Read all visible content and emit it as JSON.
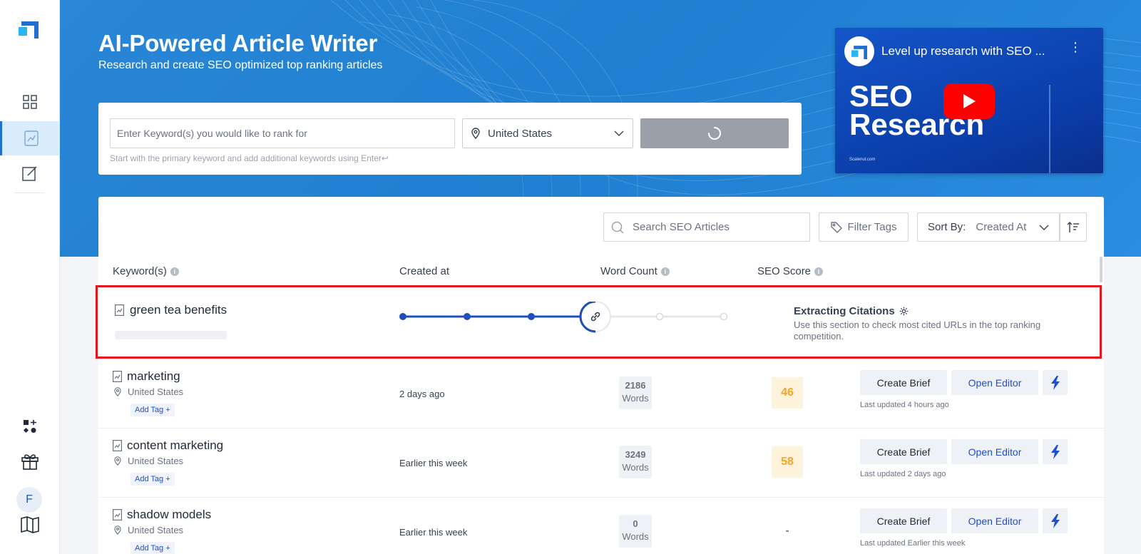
{
  "sidebar": {
    "items": [
      {
        "icon": "dashboard-grid-icon"
      },
      {
        "icon": "article-writer-icon",
        "active": true
      },
      {
        "icon": "edit-document-icon"
      }
    ],
    "bottom": [
      {
        "icon": "apps-add-icon"
      },
      {
        "icon": "gift-icon"
      },
      {
        "icon": "book-icon"
      }
    ],
    "avatar_letter": "F"
  },
  "hero": {
    "title": "AI-Powered Article Writer",
    "subtitle": "Research and create SEO optimized top ranking articles"
  },
  "search": {
    "keyword_placeholder": "Enter Keyword(s) you would like to rank for",
    "location": "United States",
    "hint": "Start with the primary keyword and add additional keywords using Enter↩",
    "submit_state": "loading"
  },
  "video": {
    "title": "Level up research with SEO ...",
    "headline_line1": "SEO",
    "headline_line2": "Research",
    "site": "Scalenut.com"
  },
  "toolbar": {
    "search_placeholder": "Search SEO Articles",
    "filter_label": "Filter Tags",
    "sort_label": "Sort By:",
    "sort_value": "Created At"
  },
  "columns": {
    "keywords": "Keyword(s)",
    "created": "Created at",
    "word_count": "Word Count",
    "seo_score": "SEO Score"
  },
  "processing_row": {
    "keyword": "green tea benefits",
    "progress_steps_total": 6,
    "progress_steps_done": 4,
    "status_title": "Extracting Citations",
    "status_desc": "Use this section to check most cited URLs in the top ranking competition."
  },
  "rows": [
    {
      "keyword": "marketing",
      "location": "United States",
      "tag": "Add Tag +",
      "created": "2 days ago",
      "words": "2186",
      "words_label": "Words",
      "score": "46",
      "brief": "Create Brief",
      "editor": "Open Editor",
      "updated": "Last updated 4 hours ago"
    },
    {
      "keyword": "content marketing",
      "location": "United States",
      "tag": "Add Tag +",
      "created": "Earlier this week",
      "words": "3249",
      "words_label": "Words",
      "score": "58",
      "brief": "Create Brief",
      "editor": "Open Editor",
      "updated": "Last updated 2 days ago"
    },
    {
      "keyword": "shadow models",
      "location": "United States",
      "tag": "Add Tag +",
      "created": "Earlier this week",
      "words": "0",
      "words_label": "Words",
      "score": "-",
      "brief": "Create Brief",
      "editor": "Open Editor",
      "updated": "Last updated Earlier this week"
    }
  ],
  "colors": {
    "brand_blue": "#1f7fd0",
    "highlight_red": "#e5141d",
    "score_orange": "#f5a524",
    "link_blue": "#1d4ed8"
  }
}
